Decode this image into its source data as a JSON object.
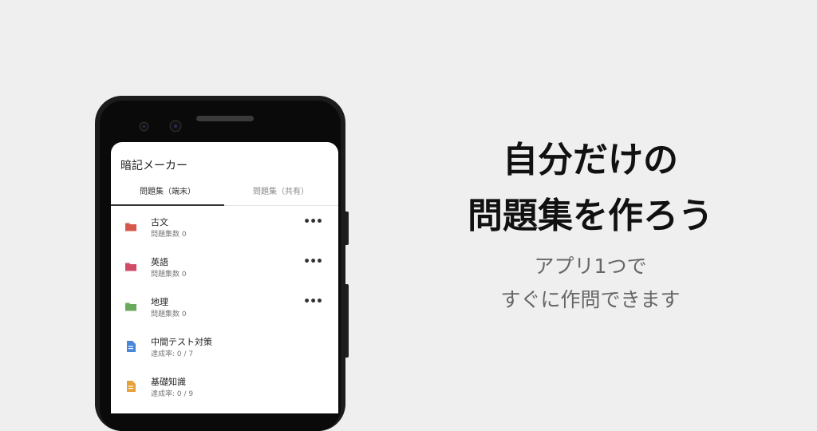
{
  "app": {
    "title": "暗記メーカー"
  },
  "tabs": [
    {
      "label": "問題集（端末）"
    },
    {
      "label": "問題集（共有）"
    }
  ],
  "items": [
    {
      "title": "古文",
      "sub": "問題集数 0",
      "icon": "folder-icon",
      "color": "#d9574a",
      "menu": "•••"
    },
    {
      "title": "英語",
      "sub": "問題集数 0",
      "icon": "folder-icon",
      "color": "#d14a66",
      "menu": "•••"
    },
    {
      "title": "地理",
      "sub": "問題集数 0",
      "icon": "folder-icon",
      "color": "#6aaa5c",
      "menu": "•••"
    },
    {
      "title": "中間テスト対策",
      "sub": "達成率: 0 / 7",
      "icon": "document-icon",
      "color": "#4a86d9"
    },
    {
      "title": "基礎知識",
      "sub": "達成率: 0 / 9",
      "icon": "document-icon",
      "color": "#e8a23c"
    }
  ],
  "promo": {
    "headline_1": "自分だけの",
    "headline_2": "問題集を作ろう",
    "sub_1": "アプリ1つで",
    "sub_2": "すぐに作問できます"
  }
}
